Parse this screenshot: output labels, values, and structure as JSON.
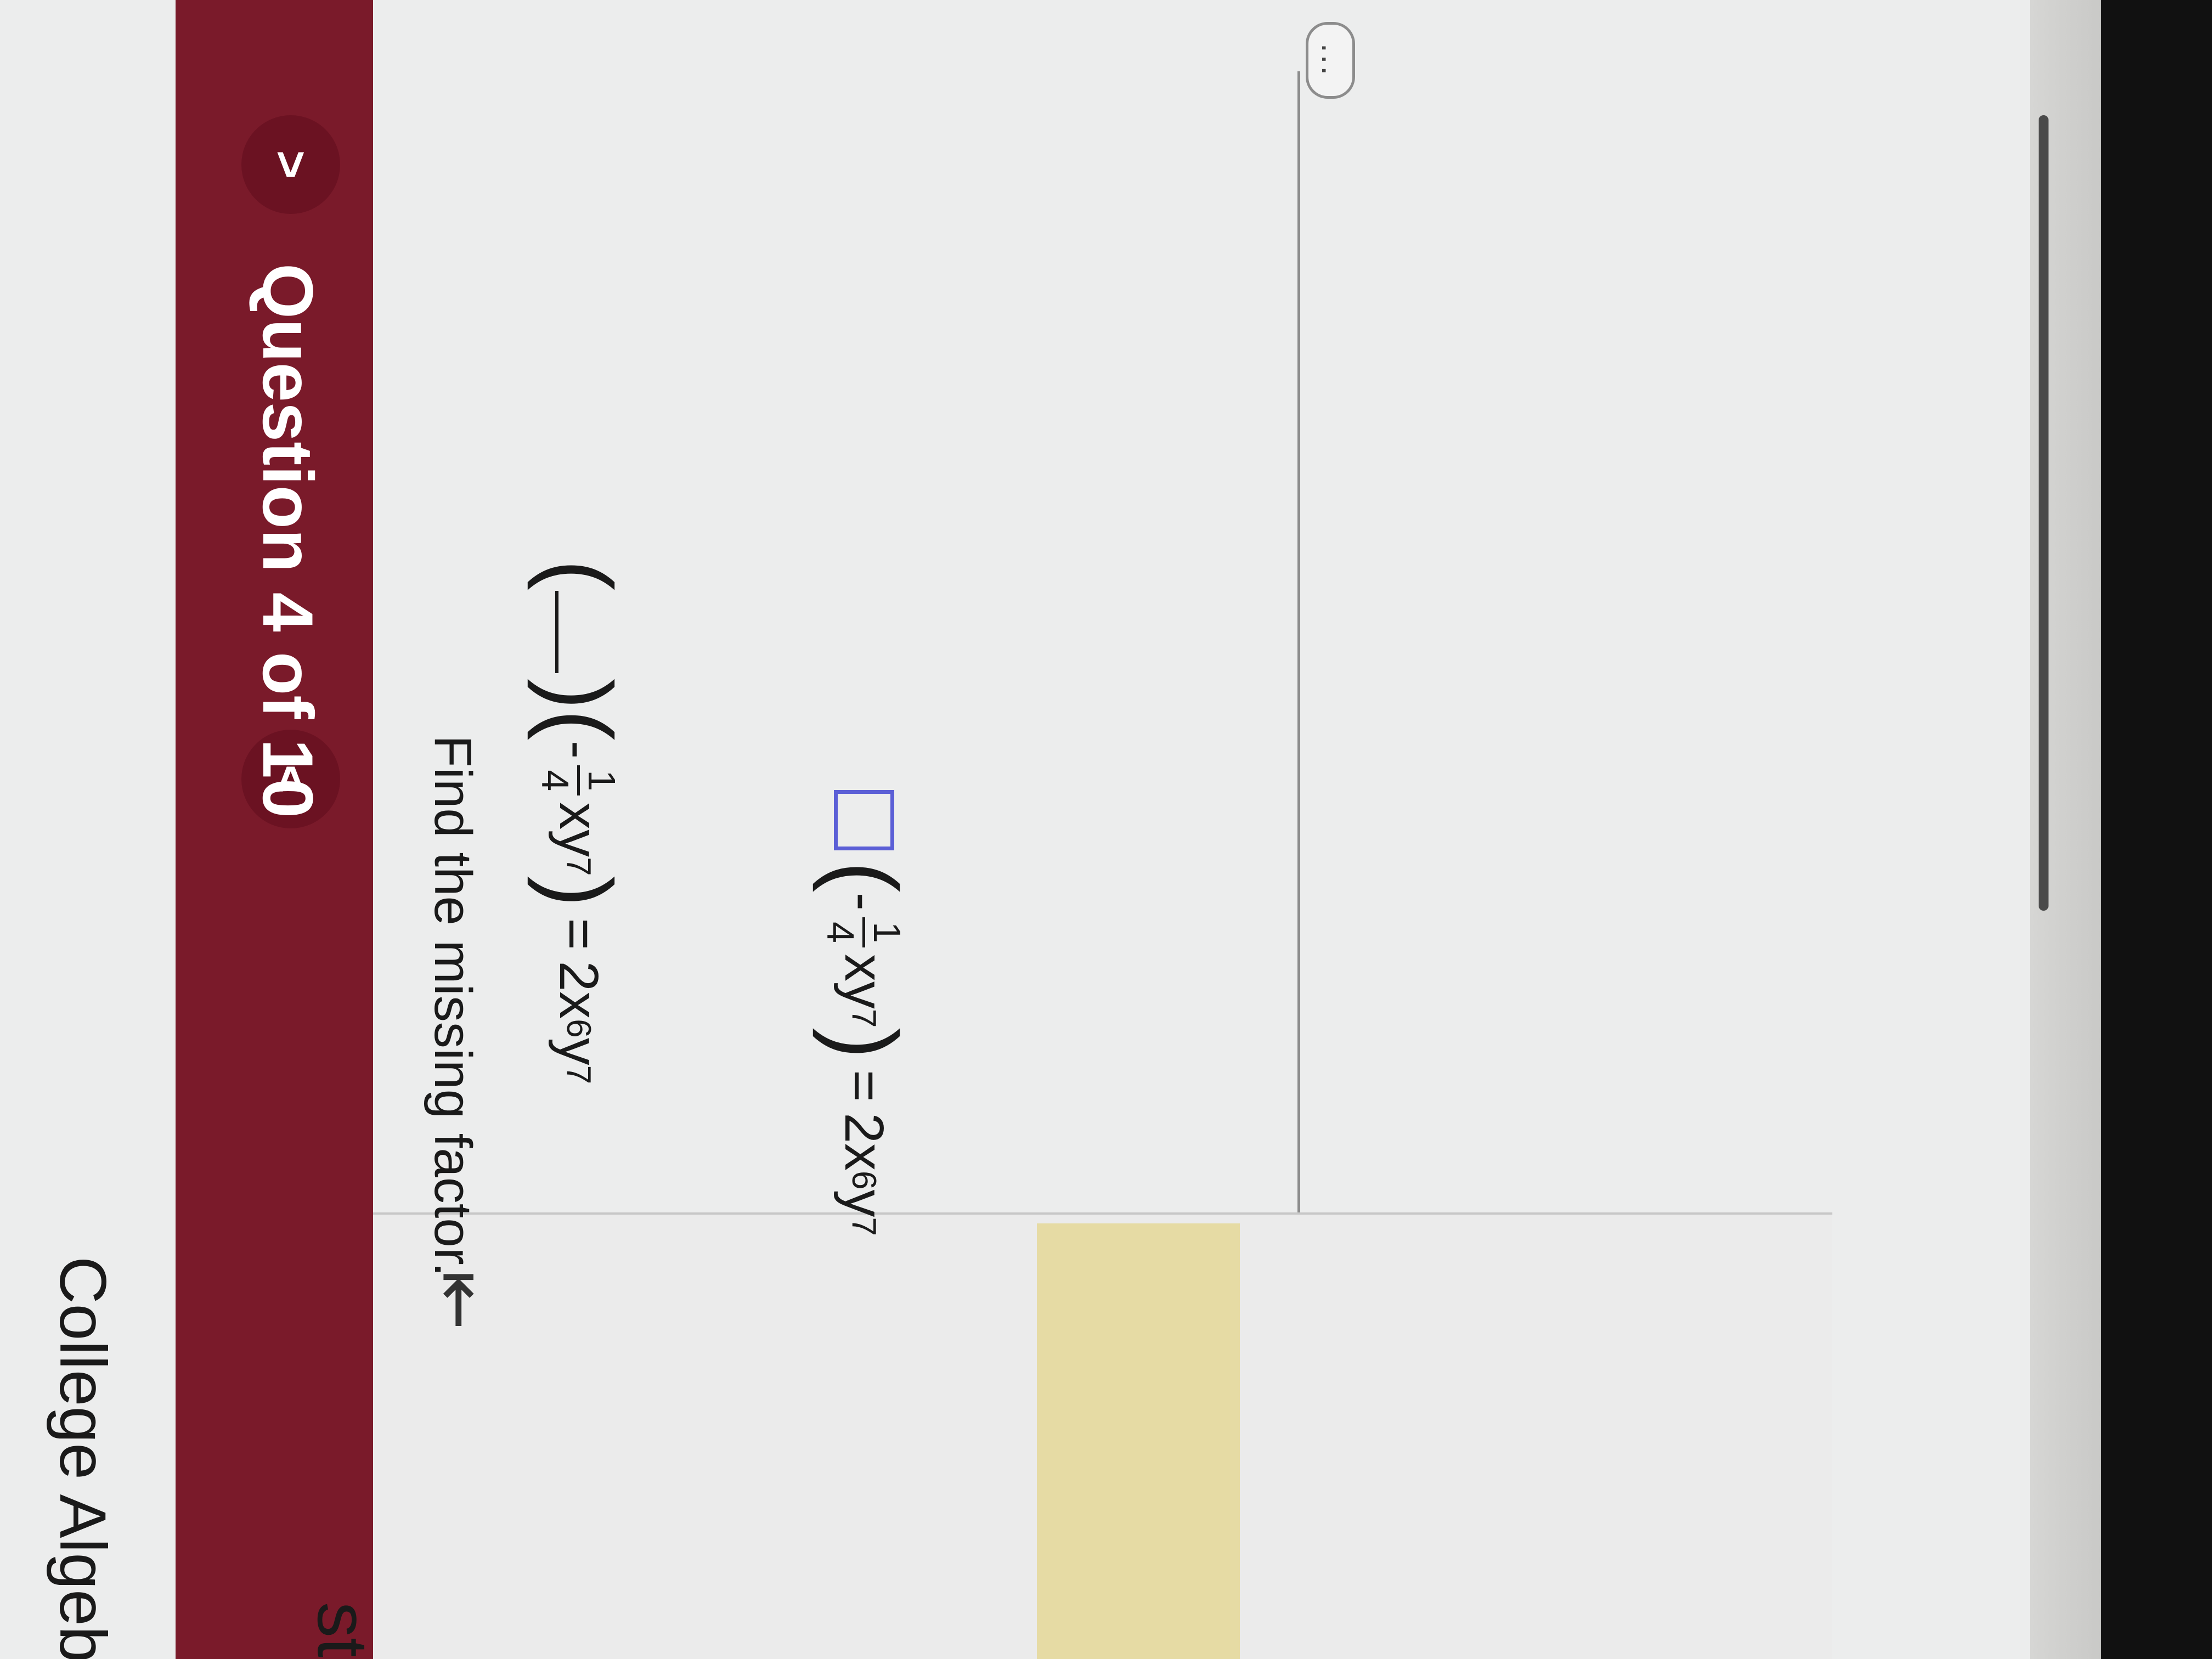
{
  "course": {
    "title": "College Algebra",
    "partial_left_text": "st"
  },
  "header": {
    "question_label": "Question 4 of 10",
    "prev_label": "<",
    "next_label": ">"
  },
  "sidebar": {
    "collapse_label": "⇤"
  },
  "question": {
    "instruction": "Find the missing factor.",
    "prompt": {
      "frac_sign": "-",
      "frac_num": "1",
      "frac_den": "4",
      "term": "xy",
      "term_exp": "7",
      "equals": "=",
      "rhs_coeff": "2x",
      "rhs_x_exp": "6",
      "rhs_y": "y",
      "rhs_y_exp": "7"
    },
    "answer": {
      "frac_sign": "-",
      "frac_num": "1",
      "frac_den": "4",
      "term": "xy",
      "term_exp": "7",
      "equals": "=",
      "rhs_coeff": "2x",
      "rhs_x_exp": "6",
      "rhs_y": "y",
      "rhs_y_exp": "7"
    },
    "more_label": "..."
  },
  "colors": {
    "header_bg": "#7a1a2a",
    "answer_box_border": "#5b5fd6",
    "sidebar_highlight": "#e6dba4"
  }
}
